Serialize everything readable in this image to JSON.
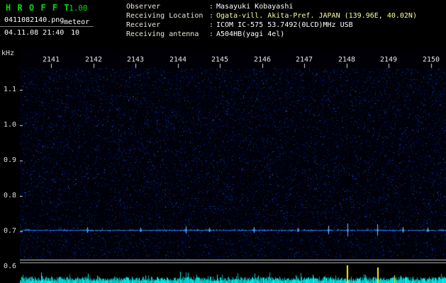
{
  "header": {
    "title": "H R O F F T",
    "version": "1.00",
    "filename": "0411082140.png",
    "mode": "meteor",
    "timestamp": "04.11.08 21:40",
    "count": "10"
  },
  "info": {
    "colon": ":",
    "rows": [
      {
        "label": "Observer",
        "value": "Masayuki Kobayashi"
      },
      {
        "label": "Receiving Location",
        "value": "Ogata-vill. Akita-Pref. JAPAN (139.96E, 40.02N)"
      },
      {
        "label": "Receiver",
        "value": "ICOM IC-575 53.7492(0LCD)MHz USB"
      },
      {
        "label": "Receiving antenna",
        "value": "A504HB(yagi 4el)"
      }
    ]
  },
  "plot": {
    "y_unit": "kHz",
    "y_ticks": [
      "1.1",
      "1.0",
      "0.9",
      "0.8",
      "0.7",
      "0.6"
    ],
    "x_ticks": [
      "2141",
      "2142",
      "2143",
      "2144",
      "2145",
      "2146",
      "2147",
      "2148",
      "2149",
      "2150"
    ],
    "carrier_khz": "0.7"
  },
  "colors": {
    "title_green": "#00dd00",
    "carrier_blue": "#3366ff",
    "signal_cyan": "#00e0e0",
    "echo_yellow": "#ffe922"
  }
}
